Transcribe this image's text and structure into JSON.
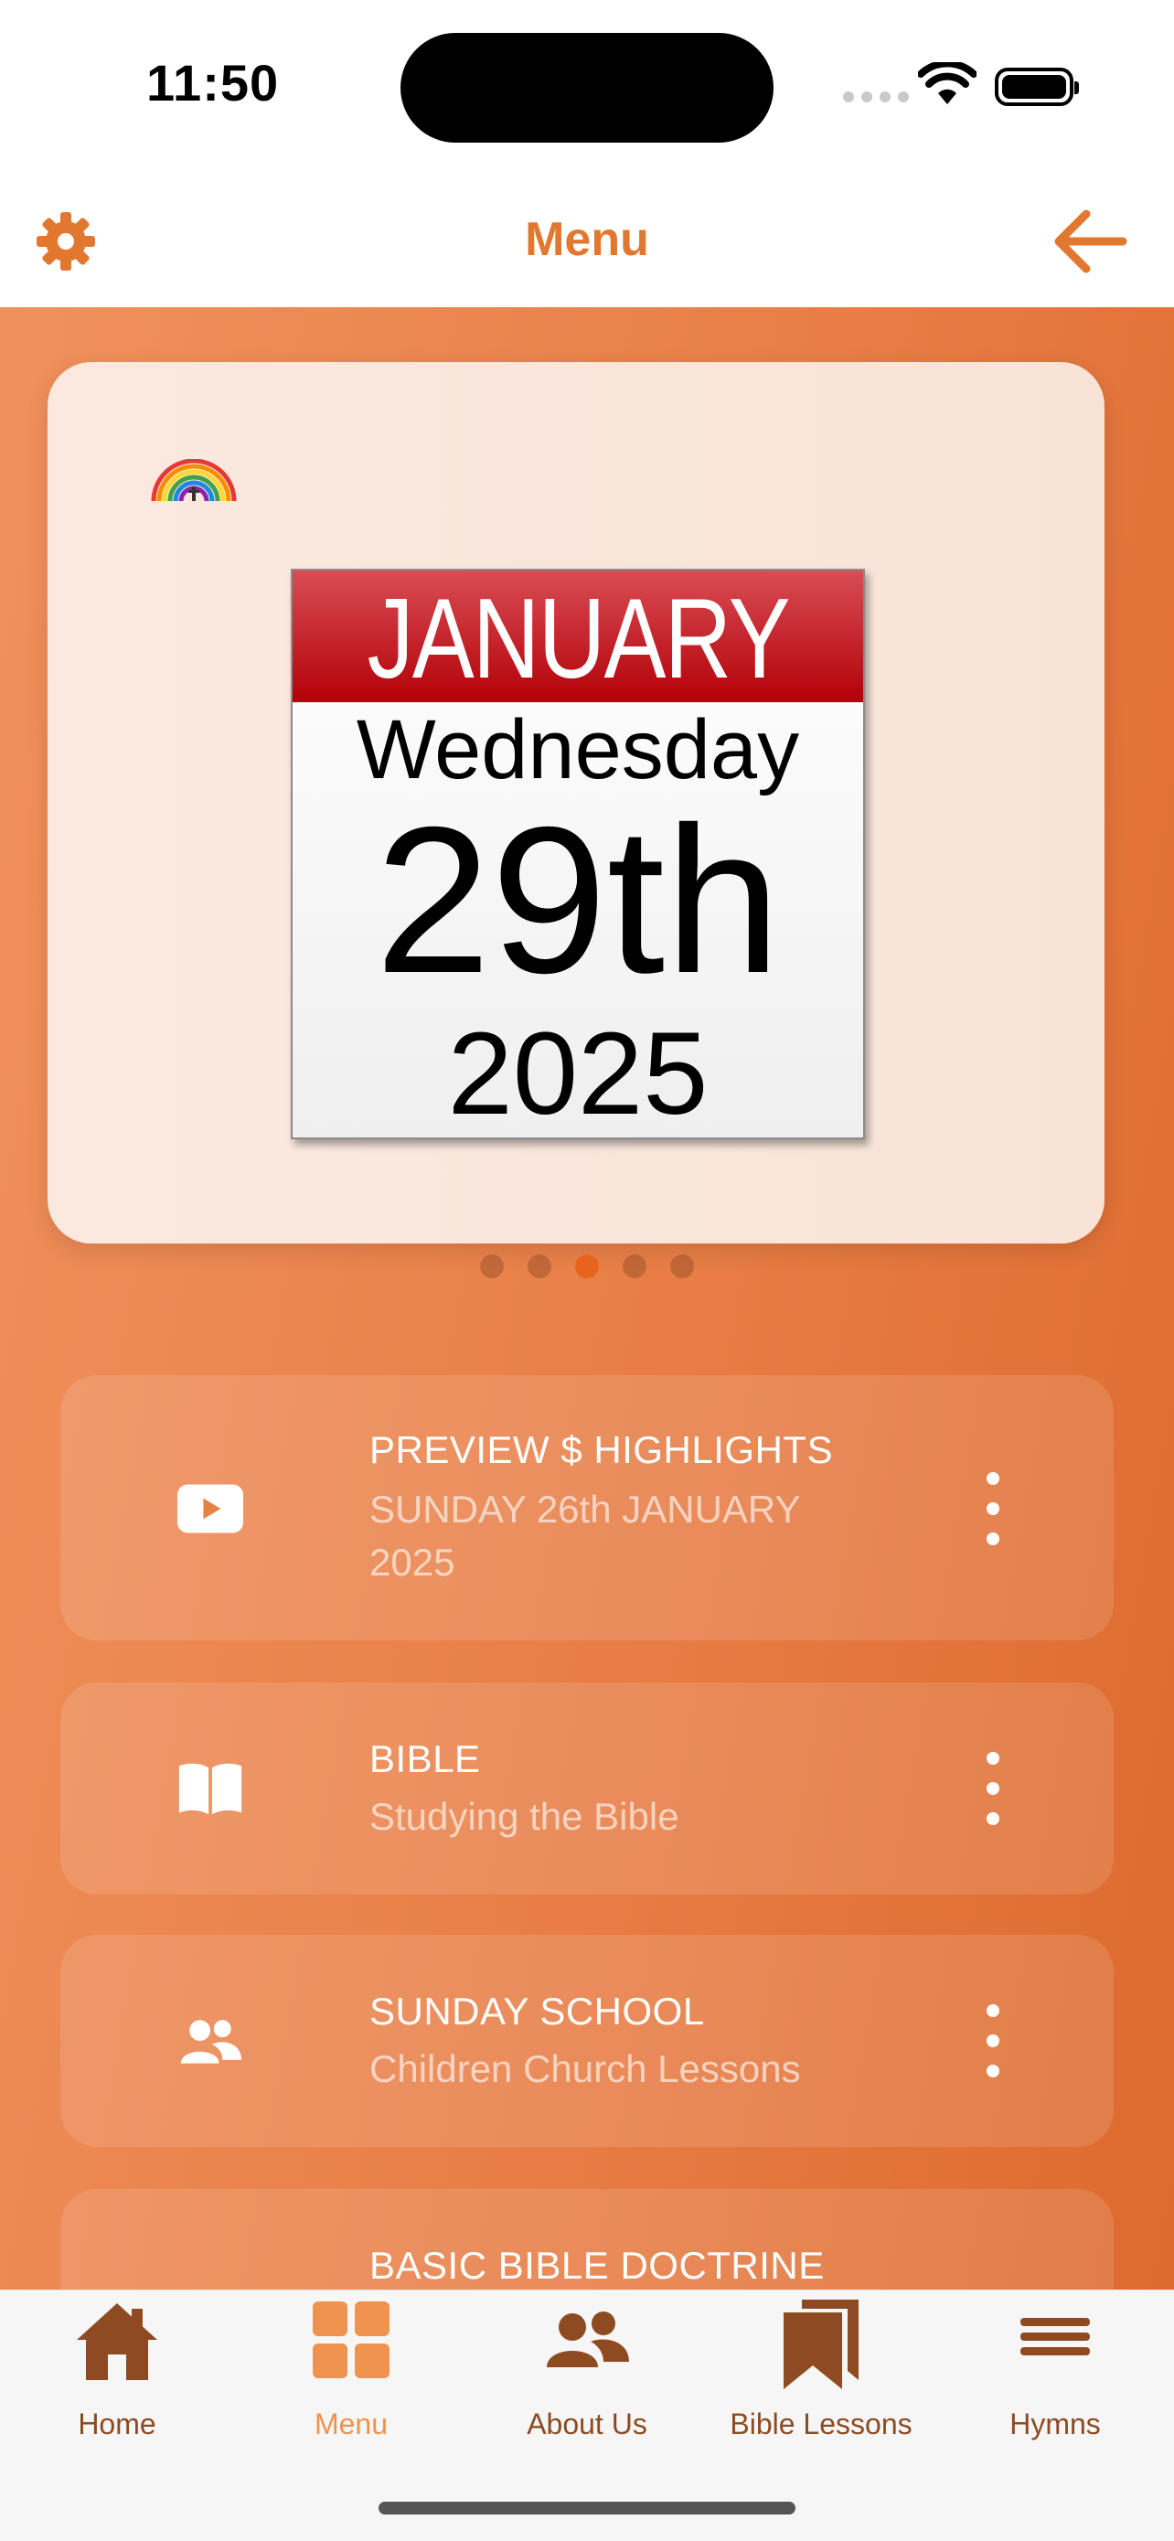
{
  "status_bar": {
    "time": "11:50"
  },
  "navbar": {
    "title": "Menu"
  },
  "carousel": {
    "calendar": {
      "month": "JANUARY",
      "weekday": "Wednesday",
      "day": "29th",
      "year": "2025"
    },
    "page_count": 5,
    "active_page": 3
  },
  "menu_items": [
    {
      "title": "PREVIEW $ HIGHLIGHTS",
      "subtitle": "SUNDAY 26th JANUARY 2025",
      "icon": "play-icon"
    },
    {
      "title": "BIBLE",
      "subtitle": "Studying the Bible",
      "icon": "book-icon"
    },
    {
      "title": "SUNDAY SCHOOL",
      "subtitle": "Children Church Lessons",
      "icon": "people-icon"
    },
    {
      "title": "BASIC BIBLE DOCTRINE",
      "subtitle": "",
      "icon": ""
    }
  ],
  "tabbar": {
    "tabs": [
      {
        "label": "Home",
        "icon": "home-icon"
      },
      {
        "label": "Menu",
        "icon": "grid-icon",
        "active": true
      },
      {
        "label": "About Us",
        "icon": "people-icon"
      },
      {
        "label": "Bible Lessons",
        "icon": "bookmark-icon"
      },
      {
        "label": "Hymns",
        "icon": "hamburger-icon"
      }
    ]
  },
  "colors": {
    "accent": "#e2772f",
    "tab_inactive": "#8e4a21",
    "tab_active": "#f0934f",
    "calendar_red": "#b30008"
  }
}
